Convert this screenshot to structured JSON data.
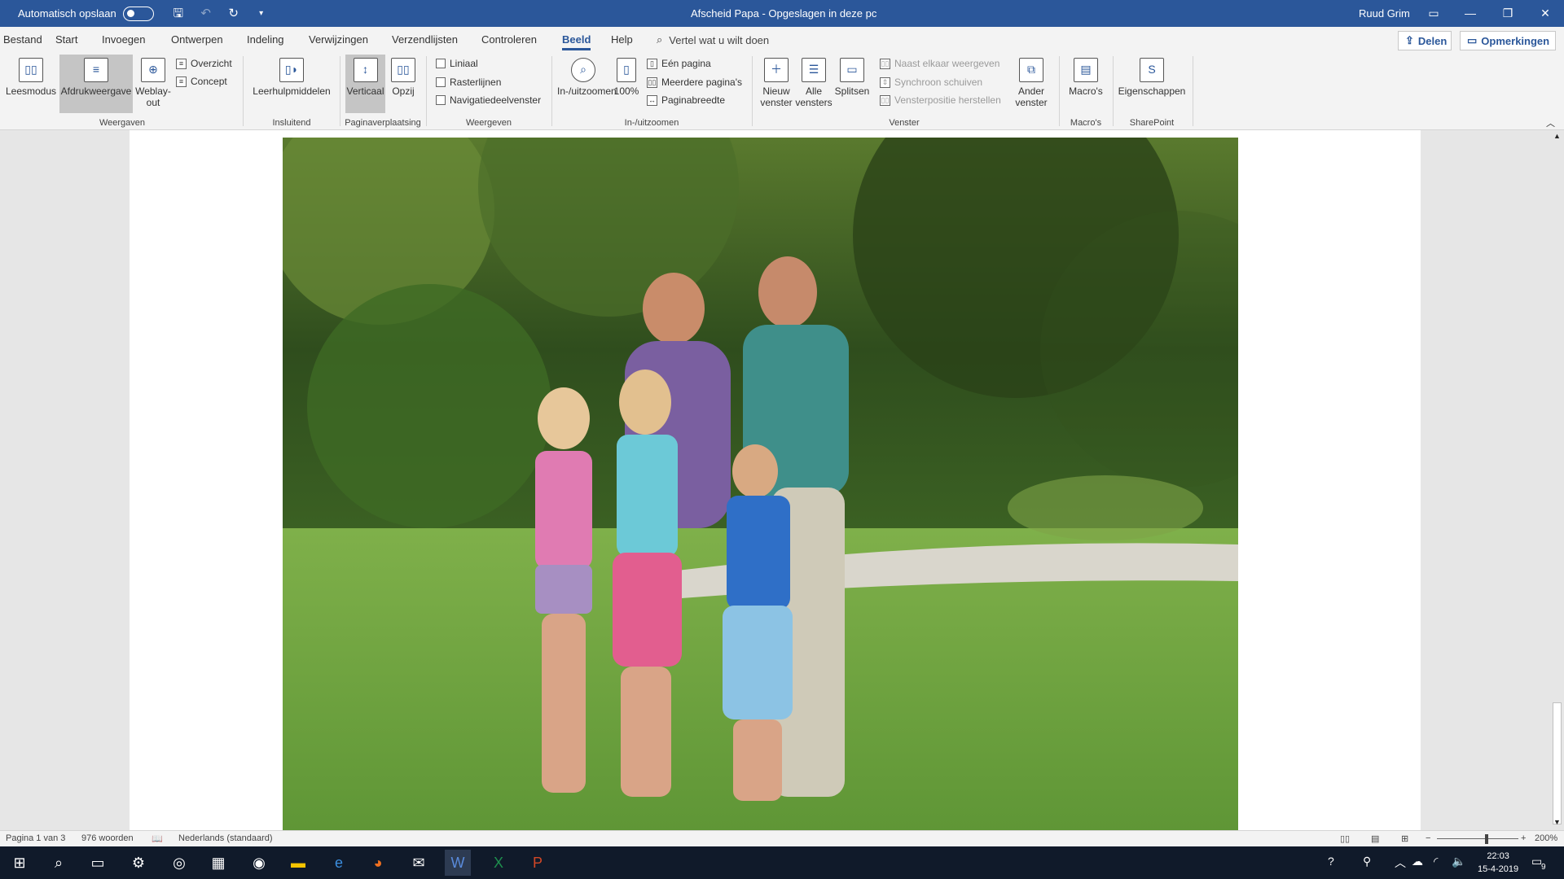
{
  "titlebar": {
    "autosave_label": "Automatisch opslaan",
    "doc_title": "Afscheid Papa  -  Opgeslagen in deze pc",
    "user": "Ruud Grim",
    "qat_icons": [
      "save-icon",
      "undo-icon",
      "redo-icon",
      "customize-icon"
    ],
    "window_buttons": [
      "ribbon-display-icon",
      "minimize-icon",
      "restore-icon",
      "close-icon"
    ]
  },
  "tabs": [
    "Bestand",
    "Start",
    "Invoegen",
    "Ontwerpen",
    "Indeling",
    "Verwijzingen",
    "Verzendlijsten",
    "Controleren",
    "Beeld",
    "Help"
  ],
  "active_tab": "Beeld",
  "tellme": "Vertel wat u wilt doen",
  "share": {
    "delen": "Delen",
    "opmerkingen": "Opmerkingen"
  },
  "ribbon": {
    "weergaven": {
      "leesmodus": "Leesmodus",
      "afdrukweergave": "Afdrukweergave",
      "weblayout": "Weblay-out",
      "overzicht": "Overzicht",
      "concept": "Concept",
      "group": "Weergaven"
    },
    "insluitend": {
      "leerhulp": "Leerhulpmiddelen",
      "group": "Insluitend"
    },
    "paginaverplaatsing": {
      "verticaal": "Verticaal",
      "opzij": "Opzij",
      "group": "Paginaverplaatsing"
    },
    "weergeven": {
      "liniaal": "Liniaal",
      "rasterlijnen": "Rasterlijnen",
      "navigatie": "Navigatiedeelvenster",
      "group": "Weergeven"
    },
    "zoom": {
      "inuit": "In-/uitzoomen",
      "pct": "100%",
      "een": "Eén pagina",
      "meerdere": "Meerdere pagina's",
      "breedte": "Paginabreedte",
      "group": "In-/uitzoomen"
    },
    "venster": {
      "nieuw": "Nieuw venster",
      "alle": "Alle vensters",
      "splitsen": "Splitsen",
      "naast": "Naast elkaar weergeven",
      "synchroon": "Synchroon schuiven",
      "positie": "Vensterpositie herstellen",
      "ander": "Ander venster",
      "group": "Venster"
    },
    "macros": {
      "label": "Macro's",
      "group": "Macro's"
    },
    "sharepoint": {
      "label": "Eigenschappen",
      "group": "SharePoint"
    }
  },
  "status": {
    "page": "Pagina 1 van 3",
    "words": "976 woorden",
    "language": "Nederlands (standaard)",
    "zoom": "200%"
  },
  "taskbar": {
    "time": "22:03",
    "date": "15-4-2019",
    "notifications": "9"
  },
  "colors": {
    "titlebar": "#2b579a",
    "taskbar": "#101a2a",
    "ribbon": "#f3f3f3"
  }
}
